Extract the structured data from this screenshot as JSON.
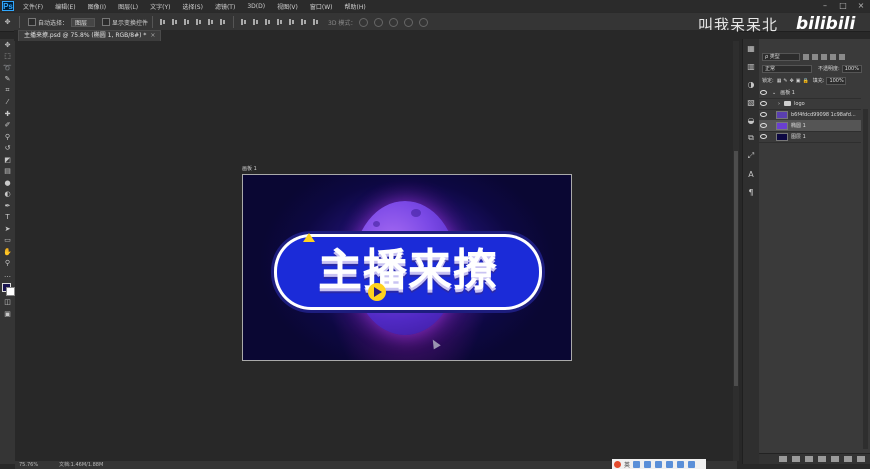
{
  "app": {
    "logo": "Ps"
  },
  "menu": [
    "文件(F)",
    "编辑(E)",
    "图像(I)",
    "图层(L)",
    "文字(Y)",
    "选择(S)",
    "滤镜(T)",
    "3D(D)",
    "视图(V)",
    "窗口(W)",
    "帮助(H)"
  ],
  "options": {
    "auto_select_label": "自动选择：",
    "auto_select_value": "图层",
    "show_transform_label": "显示变换控件",
    "mode_3d_label": "3D 模式："
  },
  "document": {
    "tab_label": "主播来撩.psd @ 75.8% (椭圆 1, RGB/8#) *",
    "close": "×",
    "artboard_label": "画板 1",
    "artwork_text": "主播来撩"
  },
  "status": {
    "zoom": "75.76%",
    "doc_size": "文档:1.46M/1.88M"
  },
  "layers_panel": {
    "filter_kind": "ρ 类型",
    "blend_mode": "正常",
    "opacity_label": "不透明度:",
    "opacity_value": "100%",
    "lock_label": "锁定:",
    "fill_label": "填充:",
    "fill_value": "100%",
    "layers": [
      {
        "name": "画板 1",
        "kind": "artboard"
      },
      {
        "name": "logo",
        "kind": "group"
      },
      {
        "name": "b6f4fdcd99098 1c98afd...",
        "kind": "layer"
      },
      {
        "name": "椭圆 1",
        "kind": "layer",
        "selected": true
      },
      {
        "name": "图层 1",
        "kind": "layer"
      }
    ]
  },
  "watermark": {
    "text": "叫我呆呆北",
    "brand": "bilibili"
  },
  "tray": {
    "ime_label": "英"
  },
  "colors": {
    "foreground": "#1a1550",
    "background": "#ffffff",
    "accent": "#31a8ff"
  }
}
